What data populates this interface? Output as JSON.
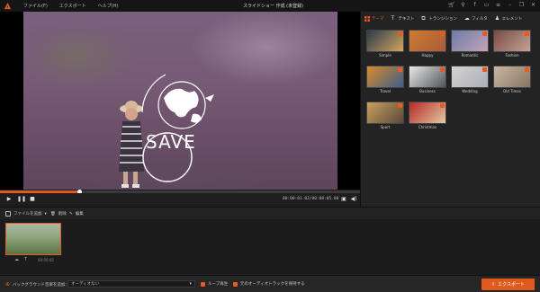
{
  "app": {
    "title": "スライドショー 作成 (未登録)",
    "menu": [
      "ファイル(F)",
      "エクスポート",
      "ヘルプ(H)"
    ]
  },
  "preview": {
    "overlay_text": "SAVE",
    "progress": 0.22,
    "timecode": "00:00:01.02/00:00:05.00"
  },
  "panel": {
    "tabs": [
      {
        "label": "テーマ",
        "active": true,
        "icon": "theme-icon"
      },
      {
        "label": "テキスト",
        "active": false,
        "icon": "text-icon"
      },
      {
        "label": "トランジション",
        "active": false,
        "icon": "transition-icon"
      },
      {
        "label": "フィルタ",
        "active": false,
        "icon": "filter-icon"
      },
      {
        "label": "エレメント",
        "active": false,
        "icon": "element-icon"
      }
    ],
    "themes": [
      {
        "name": "Simple",
        "colors": [
          "#2b3a4a",
          "#d1a560"
        ]
      },
      {
        "name": "Happy",
        "colors": [
          "#d07a30",
          "#a85c3a"
        ]
      },
      {
        "name": "Romantic",
        "colors": [
          "#6a7ca8",
          "#c7a2b8"
        ]
      },
      {
        "name": "Fashion",
        "colors": [
          "#7a4a45",
          "#c2a493"
        ]
      },
      {
        "name": "Travel",
        "colors": [
          "#d88a2a",
          "#3c5f8a"
        ]
      },
      {
        "name": "Business",
        "colors": [
          "#e9e9e9",
          "#50565c"
        ]
      },
      {
        "name": "Wedding",
        "colors": [
          "#d8d1d0",
          "#a8b0b8"
        ]
      },
      {
        "name": "Old Times",
        "colors": [
          "#c9b8a5",
          "#877463"
        ]
      },
      {
        "name": "Sport",
        "colors": [
          "#c9a061",
          "#5a4838"
        ]
      },
      {
        "name": "Christmas",
        "colors": [
          "#b42a28",
          "#e4c8a0"
        ]
      }
    ]
  },
  "media_bar": {
    "add_files": "ファイルを追加",
    "delete": "削除",
    "edit": "編集"
  },
  "timeline": {
    "clip_time": "00:00:05"
  },
  "bottom": {
    "bgm_label": "バックグラウンド音楽を追加：",
    "bgm_value": "オーディオない",
    "loop_label": "ループ再生",
    "keep_audio_label": "元のオーディオトラックを保持する",
    "export_label": "エクスポート"
  },
  "colors": {
    "accent": "#e05a1e"
  }
}
